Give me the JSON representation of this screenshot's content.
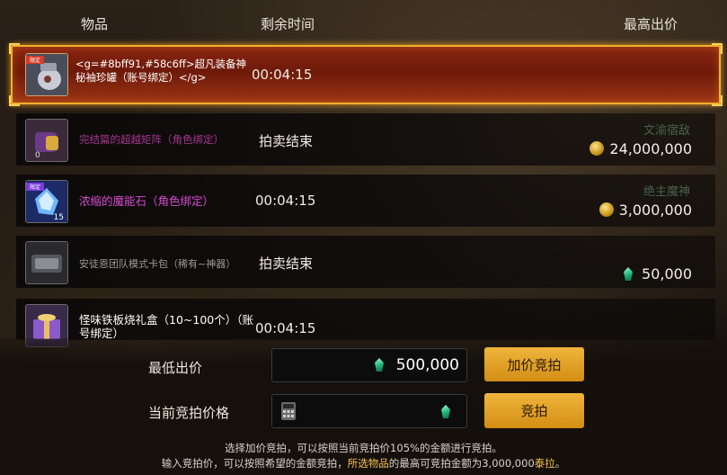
{
  "header": {
    "item": "物品",
    "time": "剩余时间",
    "highest_bid": "最高出价"
  },
  "rows": [
    {
      "name": "<g=#8bff91,#58c6ff>超凡装备神秘袖珍罐（账号绑定）</g>",
      "time": "00:04:15",
      "bidder": "",
      "price": "",
      "icon": "mystery-jar-icon",
      "name_color": "#ffffff",
      "selected": true,
      "badge": "限定"
    },
    {
      "name": "完结篇的超越矩阵（角色绑定）",
      "time": "拍卖结束",
      "bidder": "文渝宿敌",
      "price": "24,000,000",
      "icon": "matrix-bag-icon",
      "name_color": "#b83aa0",
      "selected": false
    },
    {
      "name": "浓缩的魔能石（角色绑定）",
      "time": "00:04:15",
      "bidder": "绝主魔神",
      "price": "3,000,000",
      "icon": "magic-stone-icon",
      "name_color": "#d84ad2",
      "selected": false,
      "badge": "限定",
      "count": "15"
    },
    {
      "name": "安徒恩团队模式卡包（稀有~神器）",
      "time": "拍卖结束",
      "bidder": "",
      "price": "50,000",
      "icon": "card-pack-icon",
      "name_color": "#9a9a9a",
      "selected": false
    },
    {
      "name": "怪味铁板烧礼盒（10~100个）（账号绑定）",
      "time": "00:04:15",
      "bidder": "",
      "price": "",
      "icon": "gift-box-icon",
      "name_color": "#ffffff",
      "selected": false
    }
  ],
  "bottom": {
    "min_bid_label": "最低出价",
    "min_bid_value": "500,000",
    "current_bid_label": "当前竞拍价格",
    "raise_button": "加价竞拍",
    "bid_button": "竞拍",
    "note_line1": "选择加价竞拍，可以按照当前竞拍价105%的金额进行竞拍。",
    "note_line2_a": "输入竞拍价，可以按照希望的金额竞拍，",
    "note_line2_b": "所选物品",
    "note_line2_c": "的最高可竞拍金额为3,000,000",
    "note_line2_d": "泰拉",
    "note_line2_e": "。"
  },
  "colors": {
    "accent": "#f0b12a",
    "selected_row": "#8a2410",
    "button": "#e3a027",
    "gem": "#1fb37a"
  }
}
